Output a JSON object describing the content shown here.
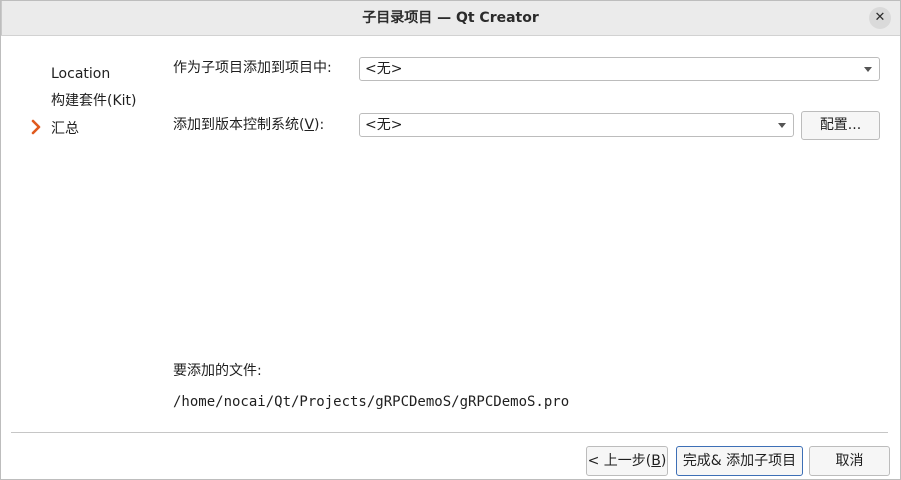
{
  "window": {
    "title": "子目录项目 — Qt Creator",
    "close_glyph": "✕"
  },
  "steps": {
    "items": [
      {
        "label": "Location",
        "current": false
      },
      {
        "label": "构建套件(Kit)",
        "current": false
      },
      {
        "label": "汇总",
        "current": true
      }
    ]
  },
  "form": {
    "add_to_project_label": "作为子项目添加到项目中:",
    "add_to_project_value": "<无>",
    "vcs_label_prefix": "添加到版本控制系统(",
    "vcs_label_mnemonic": "V",
    "vcs_label_suffix": "):",
    "vcs_value": "<无>",
    "configure_label": "配置..."
  },
  "files": {
    "label": "要添加的文件:",
    "paths": [
      "/home/nocai/Qt/Projects/gRPCDemoS/gRPCDemoS.pro"
    ]
  },
  "buttons": {
    "back_prefix": "< 上一步(",
    "back_mnemonic": "B",
    "back_suffix": ")",
    "finish_label": "完成& 添加子项目",
    "cancel_label": "取消"
  },
  "colors": {
    "current_step_arrow": "#e05a1e",
    "focus_border": "#3d6fb6"
  }
}
